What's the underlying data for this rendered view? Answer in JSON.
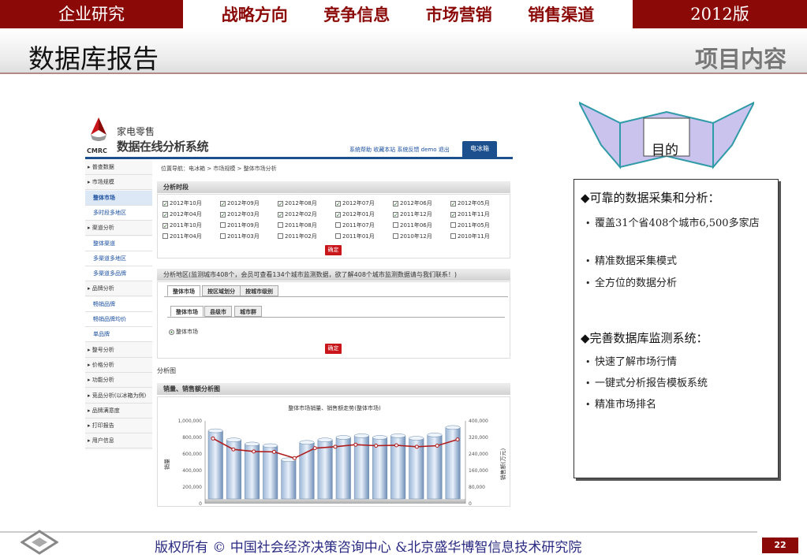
{
  "header": {
    "left_label": "企业研究",
    "nav": [
      "战略方向",
      "竞争信息",
      "市场营销",
      "销售渠道"
    ],
    "right_label": "2012版"
  },
  "title": "数据库报告",
  "subtitle": "项目内容",
  "app": {
    "logo_line1": "家电零售",
    "logo_line2": "数据在线分析系统",
    "logo_abbr": "CMRC",
    "top_links": "系统帮助  收藏本站  系统反馈  demo  退出",
    "active_tab": "电冰箱",
    "sidebar": [
      {
        "label": "普查数据",
        "type": "group"
      },
      {
        "label": "市场规模",
        "type": "group"
      },
      {
        "label": "整体市场",
        "type": "sub-selected"
      },
      {
        "label": "多时段多地区",
        "type": "sub"
      },
      {
        "label": "渠道分析",
        "type": "group"
      },
      {
        "label": "整体渠道",
        "type": "sub"
      },
      {
        "label": "多渠道多地区",
        "type": "sub"
      },
      {
        "label": "多渠道多品牌",
        "type": "sub"
      },
      {
        "label": "品牌分析",
        "type": "group"
      },
      {
        "label": "畅销品牌",
        "type": "sub"
      },
      {
        "label": "畅销品牌均价",
        "type": "sub"
      },
      {
        "label": "单品牌",
        "type": "sub"
      },
      {
        "label": "整号分析",
        "type": "group"
      },
      {
        "label": "价格分析",
        "type": "group"
      },
      {
        "label": "功能分析",
        "type": "group"
      },
      {
        "label": "竞品分析(以冰箱为例)",
        "type": "group"
      },
      {
        "label": "品牌满意度",
        "type": "group"
      },
      {
        "label": "打印报告",
        "type": "group"
      },
      {
        "label": "用户信息",
        "type": "group"
      }
    ],
    "breadcrumb": "位置导航：电冰箱 > 市场规模 > 整体市场分析",
    "period_header": "分析时段",
    "periods": [
      {
        "label": "2012年10月",
        "checked": true
      },
      {
        "label": "2012年09月",
        "checked": true
      },
      {
        "label": "2012年08月",
        "checked": true
      },
      {
        "label": "2012年07月",
        "checked": true
      },
      {
        "label": "2012年06月",
        "checked": true
      },
      {
        "label": "2012年05月",
        "checked": true
      },
      {
        "label": "2012年04月",
        "checked": true
      },
      {
        "label": "2012年03月",
        "checked": true
      },
      {
        "label": "2012年02月",
        "checked": true
      },
      {
        "label": "2012年01月",
        "checked": true
      },
      {
        "label": "2011年12月",
        "checked": true
      },
      {
        "label": "2011年11月",
        "checked": true
      },
      {
        "label": "2011年10月",
        "checked": true
      },
      {
        "label": "2011年09月",
        "checked": false
      },
      {
        "label": "2011年08月",
        "checked": false
      },
      {
        "label": "2011年07月",
        "checked": false
      },
      {
        "label": "2011年06月",
        "checked": false
      },
      {
        "label": "2011年05月",
        "checked": false
      },
      {
        "label": "2011年04月",
        "checked": false
      },
      {
        "label": "2011年03月",
        "checked": false
      },
      {
        "label": "2011年02月",
        "checked": false
      },
      {
        "label": "2011年01月",
        "checked": false
      },
      {
        "label": "2010年12月",
        "checked": false
      },
      {
        "label": "2010年11月",
        "checked": false
      }
    ],
    "confirm_label": "确定",
    "region_header": "分析地区(监测城市408个，会员可查看134个城市监测数据，欲了解408个城市监测数据请与我们联系！)",
    "region_tabs": [
      "整体市场",
      "按区域划分",
      "按城市级别"
    ],
    "region_subtabs": [
      "整体市场",
      "县级市",
      "城市群"
    ],
    "region_radio": "整体市场",
    "analysis_label": "分析图",
    "chart_header": "销量、销售额分析图"
  },
  "chart_data": {
    "type": "bar",
    "title": "整体市场销量、销售额走势(整体市场)",
    "ylabel": "销量",
    "y2label": "销售额(万元)",
    "ylim": [
      0,
      1000000
    ],
    "y2lim": [
      0,
      400000
    ],
    "yticks": [
      "0",
      "200,000",
      "400,000",
      "600,000",
      "800,000",
      "1,000,000"
    ],
    "y2ticks": [
      "0",
      "80,000",
      "160,000",
      "240,000",
      "320,000",
      "400,000"
    ],
    "series": [
      {
        "name": "销量",
        "type": "bar",
        "values": [
          880000,
          770000,
          720000,
          700000,
          530000,
          740000,
          770000,
          800000,
          820000,
          800000,
          820000,
          790000,
          830000,
          920000
        ]
      },
      {
        "name": "销售额",
        "type": "line",
        "values": [
          315000,
          262000,
          252000,
          250000,
          220000,
          268000,
          275000,
          285000,
          280000,
          282000,
          275000,
          280000,
          310000
        ]
      }
    ]
  },
  "purpose": {
    "label": "目的"
  },
  "info": {
    "heading1": "◆可靠的数据采集和分析：",
    "items1": [
      "覆盖31个省408个城市6,500多家店",
      "精准数据采集模式",
      "全方位的数据分析"
    ],
    "heading2": "◆完善数据库监测系统：",
    "items2": [
      "快速了解市场行情",
      "一键式分析报告模板系统",
      "精准市场排名"
    ]
  },
  "footer": {
    "text": "版权所有 ©  中国社会经济决策咨询中心 &北京盛华博智信息技术研究院",
    "page": "22"
  },
  "colors": {
    "brand": "#8b0a08",
    "app_blue": "#1b4f8e",
    "confirm_red": "#c8161a",
    "line_red": "#b01c1c",
    "ribbon": "#c9c3ee"
  }
}
